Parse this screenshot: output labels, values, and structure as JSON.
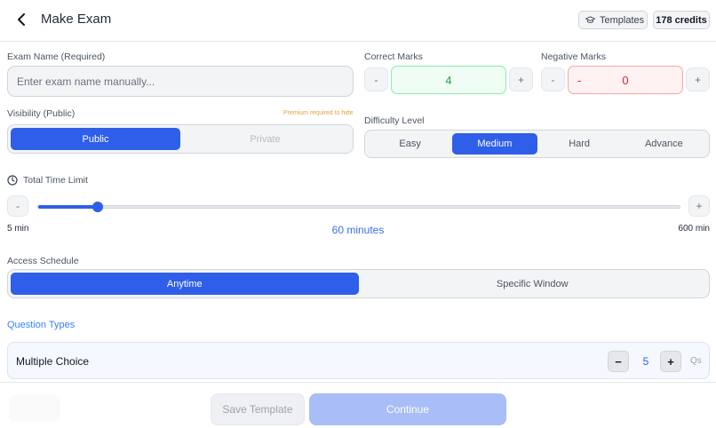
{
  "header": {
    "title": "Make Exam",
    "templates_label": "Templates",
    "credits": "178 credits"
  },
  "exam_name": {
    "label": "Exam Name (Required)",
    "placeholder": "Enter exam name manually...",
    "value": ""
  },
  "correct_marks": {
    "label": "Correct Marks",
    "value": "4",
    "minus": "-",
    "plus": "+"
  },
  "negative_marks": {
    "label": "Negative Marks",
    "sign": "-",
    "value": "0",
    "minus": "-",
    "plus": "+"
  },
  "visibility": {
    "label": "Visibility (Public)",
    "note": "Premium required to hide",
    "options": [
      "Public",
      "Private"
    ],
    "selected": "Public"
  },
  "difficulty": {
    "label": "Difficulty Level",
    "options": [
      "Easy",
      "Medium",
      "Hard",
      "Advance"
    ],
    "selected": "Medium"
  },
  "time_limit": {
    "label": "Total Time Limit",
    "minus": "-",
    "plus": "+",
    "min_label": "5 min",
    "max_label": "600 min",
    "value_label": "60 minutes",
    "value": 60,
    "min": 5,
    "max": 600
  },
  "access_schedule": {
    "label": "Access Schedule",
    "options": [
      "Anytime",
      "Specific Window"
    ],
    "selected": "Anytime"
  },
  "question_types": {
    "title": "Question Types",
    "items": [
      {
        "name": "Multiple Choice",
        "count": "5",
        "unit": "Qs",
        "minus": "−",
        "plus": "+"
      }
    ]
  },
  "footer": {
    "save_template": "Save Template",
    "continue": "Continue"
  },
  "colors": {
    "accent": "#2f5fe8",
    "positive": "#22a046",
    "negative": "#dc2626",
    "note": "#e2a33b"
  },
  "icons": [
    "back-arrow-icon",
    "graduation-cap-icon",
    "clock-icon"
  ]
}
